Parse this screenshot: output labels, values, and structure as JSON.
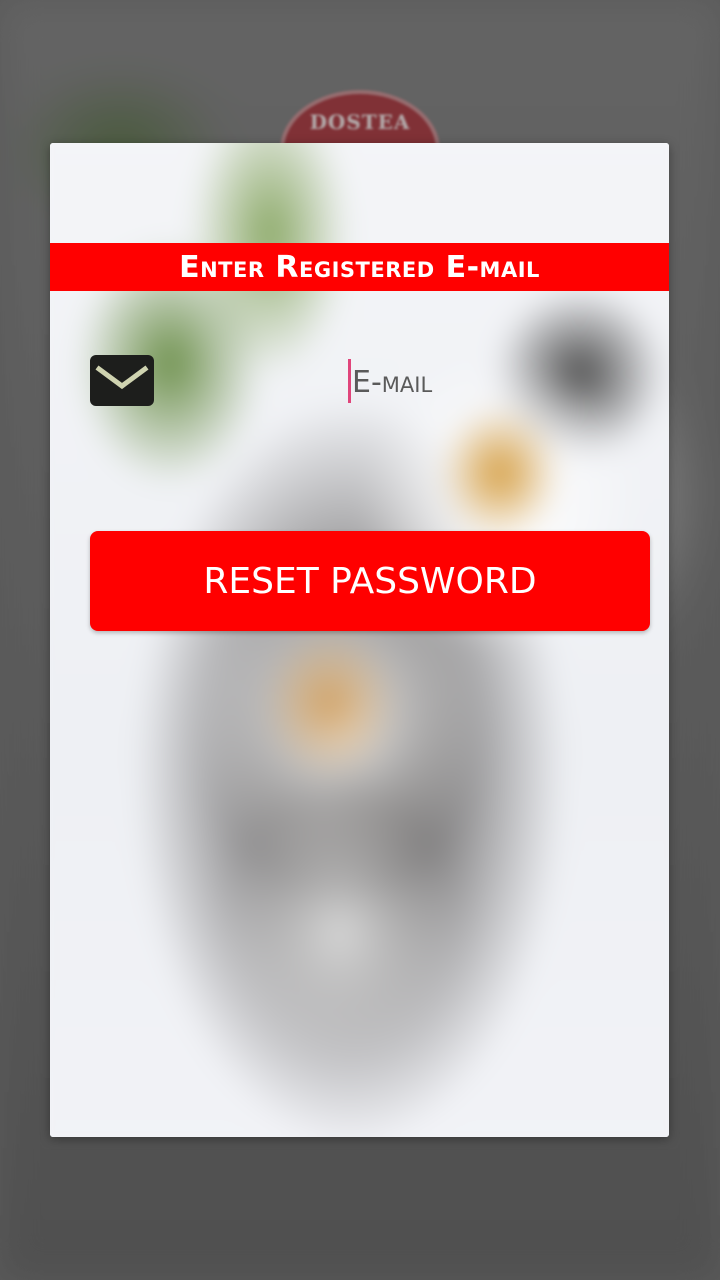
{
  "background": {
    "logo_text": "DOSTEA"
  },
  "dialog": {
    "title": "Enter Registered E-mail",
    "email_field": {
      "placeholder": "E-mail",
      "value": "",
      "icon": "mail-icon"
    },
    "reset_button_label": "RESET PASSWORD"
  },
  "colors": {
    "accent": "#ff0000",
    "button_text": "#ffffff",
    "cursor": "#e0457b"
  }
}
